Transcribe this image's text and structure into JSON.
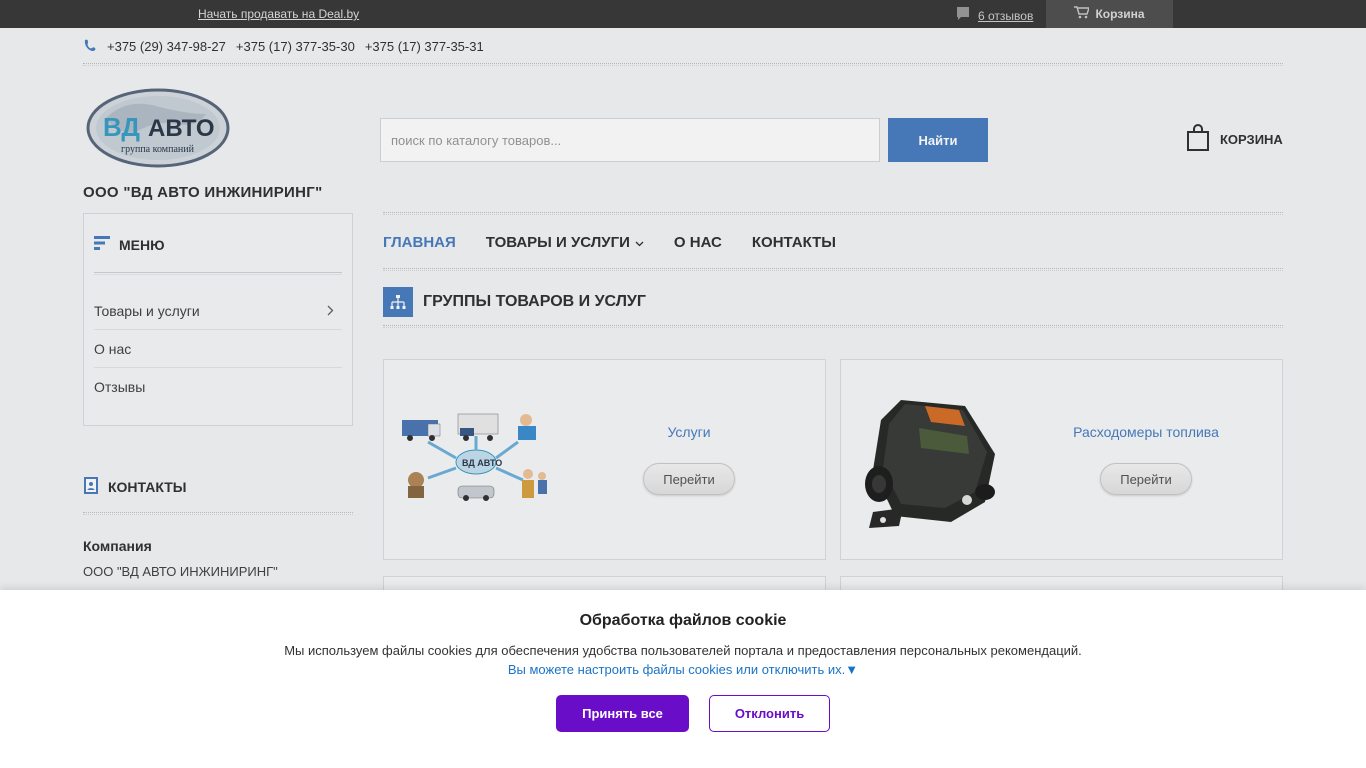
{
  "topbar": {
    "sell_link": "Начать продавать на Deal.by",
    "reviews_label": "6 отзывов",
    "cart_label": "Корзина"
  },
  "phones": [
    "+375 (29) 347-98-27",
    "+375 (17) 377-35-30",
    "+375 (17) 377-35-31"
  ],
  "header": {
    "logo_text_main": "ВД АВТО",
    "logo_text_sub": "группа компаний",
    "company_name": "ООО \"ВД АВТО ИНЖИНИРИНГ\"",
    "search_placeholder": "поиск по каталогу товаров...",
    "search_button": "Найти",
    "cart_label": "КОРЗИНА"
  },
  "sidebar": {
    "menu_title": "МЕНЮ",
    "items": [
      {
        "label": "Товары и услуги"
      },
      {
        "label": "О нас"
      },
      {
        "label": "Отзывы"
      }
    ],
    "contacts_title": "КОНТАКТЫ",
    "company_label": "Компания",
    "company_value": "ООО \"ВД АВТО ИНЖИНИРИНГ\""
  },
  "nav": {
    "items": [
      {
        "label": "ГЛАВНАЯ"
      },
      {
        "label": "ТОВАРЫ И УСЛУГИ"
      },
      {
        "label": "О НАС"
      },
      {
        "label": "КОНТАКТЫ"
      }
    ]
  },
  "section": {
    "title": "ГРУППЫ ТОВАРОВ И УСЛУГ"
  },
  "cards": [
    {
      "title": "Услуги",
      "button": "Перейти"
    },
    {
      "title": "Расходомеры топлива",
      "button": "Перейти"
    }
  ],
  "cookie": {
    "title": "Обработка файлов cookie",
    "text": "Мы используем файлы cookies для обеспечения удобства пользователей портала и предоставления персональных рекомендаций.",
    "link": "Вы можете настроить файлы cookies или отключить их.▼",
    "accept": "Принять все",
    "decline": "Отклонить"
  },
  "colors": {
    "accent": "#4a7fc2",
    "cookie_accent": "#6a0dc8",
    "topbar": "#3a3a3a"
  }
}
